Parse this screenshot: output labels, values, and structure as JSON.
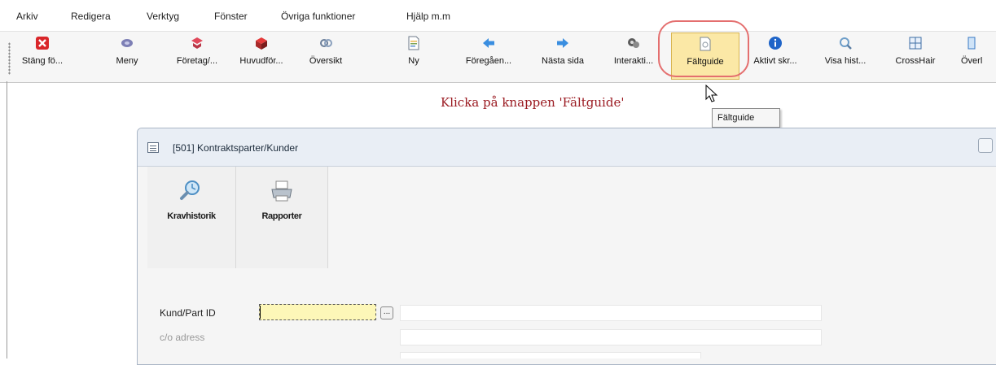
{
  "menu": {
    "items": [
      "Arkiv",
      "Redigera",
      "Verktyg",
      "Fönster",
      "Övriga funktioner",
      "Hjälp m.m"
    ]
  },
  "toolbar": {
    "buttons": [
      {
        "label": "Stäng fö...",
        "icon": "close-icon"
      },
      {
        "label": "Meny",
        "icon": "menu-icon"
      },
      {
        "label": "Företag/...",
        "icon": "company-icon"
      },
      {
        "label": "Huvudför...",
        "icon": "main-ledger-icon"
      },
      {
        "label": "Översikt",
        "icon": "overview-icon"
      },
      {
        "label": "Ny",
        "icon": "new-document-icon"
      },
      {
        "label": "Föregåen...",
        "icon": "arrow-left-icon"
      },
      {
        "label": "Nästa sida",
        "icon": "arrow-right-icon"
      },
      {
        "label": "Interakti...",
        "icon": "interaction-icon"
      },
      {
        "label": "Fältguide",
        "icon": "field-guide-icon"
      },
      {
        "label": "Aktivt skr...",
        "icon": "info-icon"
      },
      {
        "label": "Visa hist...",
        "icon": "history-icon"
      },
      {
        "label": "CrossHair",
        "icon": "crosshair-icon"
      },
      {
        "label": "Överl",
        "icon": "overlay-icon"
      }
    ]
  },
  "instruction": "Klicka på knappen 'Fältguide'",
  "tooltip": "Fältguide",
  "window": {
    "title": "[501]  Kontraktsparter/Kunder",
    "ribbon": [
      {
        "label": "Kravhistorik",
        "icon": "claim-history-icon"
      },
      {
        "label": "Rapporter",
        "icon": "printer-icon"
      }
    ],
    "form": {
      "kund_label": "Kund/Part ID",
      "co_label": "c/o adress",
      "lookup": "..."
    }
  },
  "colors": {
    "instruction": "#9b1b22",
    "callout": "#e46f6f",
    "active_field": "#fdf7b8"
  }
}
